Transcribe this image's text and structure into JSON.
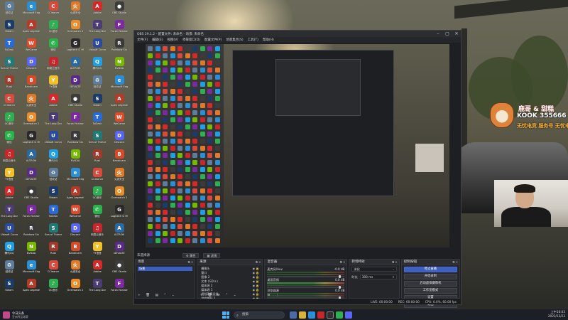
{
  "desktop": {
    "icons": [
      {
        "label": "回收站",
        "color": "#5f7d9a",
        "glyph": "♻"
      },
      {
        "label": "Microsoft Edge",
        "color": "#2a8fd6",
        "glyph": "e"
      },
      {
        "label": "CCleaner",
        "color": "#d94a3c",
        "glyph": "C"
      },
      {
        "label": "火绒安全",
        "color": "#e07a2a",
        "glyph": "火"
      },
      {
        "label": "Adobe",
        "color": "#d62a2a",
        "glyph": "A"
      },
      {
        "label": "OBS Studio",
        "color": "#3c3c3c",
        "glyph": "●"
      },
      {
        "label": "Steam",
        "color": "#1b3b6a",
        "glyph": "S"
      },
      {
        "label": "Apex Legends",
        "color": "#b43b2a",
        "glyph": "A"
      },
      {
        "label": "QQ音乐",
        "color": "#2fae52",
        "glyph": "♪"
      },
      {
        "label": "Overwatch 2",
        "color": "#e88d2a",
        "glyph": "O"
      },
      {
        "label": "The Long Dark",
        "color": "#4c3c76",
        "glyph": "T"
      },
      {
        "label": "Forza Horizon",
        "color": "#7b2aa0",
        "glyph": "F"
      },
      {
        "label": "ToDesk",
        "color": "#2a6ad6",
        "glyph": "T"
      },
      {
        "label": "WeGame",
        "color": "#e04a2a",
        "glyph": "W"
      },
      {
        "label": "微信",
        "color": "#29b34a",
        "glyph": "✆"
      },
      {
        "label": "Logitech G HUB",
        "color": "#2a2a2a",
        "glyph": "G"
      },
      {
        "label": "Ubisoft Connect",
        "color": "#2a4aa0",
        "glyph": "U"
      },
      {
        "label": "Rainbow Six",
        "color": "#3a3a3a",
        "glyph": "R"
      },
      {
        "label": "Sea of Thieves",
        "color": "#1f7a78",
        "glyph": "S"
      },
      {
        "label": "Discord",
        "color": "#5865f2",
        "glyph": "D"
      },
      {
        "label": "网易云音乐",
        "color": "#c8262a",
        "glyph": "♫"
      },
      {
        "label": "ALTRON",
        "color": "#2a6aa0",
        "glyph": "A"
      },
      {
        "label": "腾讯QQ",
        "color": "#1fa0e6",
        "glyph": "Q"
      },
      {
        "label": "NVIDIA",
        "color": "#76b900",
        "glyph": "N"
      },
      {
        "label": "Rust",
        "color": "#a03a2a",
        "glyph": "R"
      },
      {
        "label": "Bandicam",
        "color": "#d64a2a",
        "glyph": "B"
      },
      {
        "label": "YY语音",
        "color": "#f2c12a",
        "glyph": "Y"
      },
      {
        "label": "DEVIATE",
        "color": "#5a2a8a",
        "glyph": "D"
      }
    ]
  },
  "obs": {
    "title": "OBS 29.1.2 - 配置文件: 未命名 - 场景: 未命名",
    "menu": [
      "文件(F)",
      "编辑(E)",
      "视图(V)",
      "停靠窗口(D)",
      "配置文件(P)",
      "场景集合(S)",
      "工具(T)",
      "帮助(H)"
    ],
    "scene_label": "场景",
    "scene_current": "未选择源",
    "scene_tabs": [
      "⚙ 属性",
      "▦ 滤镜"
    ],
    "docks": {
      "scenes": {
        "title": "场景",
        "items": [
          "场景"
        ],
        "footer": "+ 🗑 ▤ ⌃ ⌄"
      },
      "sources": {
        "title": "来源",
        "items": [
          "摄像头",
          "窗口",
          "图像 2",
          "文本 (GDI+)",
          "媒体源 2",
          "媒体源 1",
          "视频采集设备",
          "游戏捕获 2"
        ],
        "footer": "+ 🗑 ⚙ ⌃ ⌄"
      },
      "mixer": {
        "title": "混音器",
        "tracks": [
          {
            "name": "麦克风/Aux",
            "db": "-0.0 dB"
          },
          {
            "name": "桌面音频",
            "db": "0.0 dB"
          },
          {
            "name": "浏览器源",
            "db": "0.0 dB"
          }
        ],
        "footer": "⚙ ⋮"
      },
      "transitions": {
        "title": "转场特效",
        "type": "淡化",
        "duration_label": "时长",
        "duration": "300 ms"
      },
      "controls": {
        "title": "控制按钮",
        "buttons": [
          "停止直播",
          "开始录制",
          "启动虚拟摄像机",
          "工作室模式",
          "设置",
          "退出"
        ]
      }
    },
    "status": {
      "live": "LIVE: 00:00:00",
      "rec": "REC: 00:00:00",
      "cpu": "CPU: 0.0%, 60.00 fps"
    }
  },
  "brand": {
    "top": "鹿哥 & 甜糕",
    "kook": "KOOK 355666",
    "sub": "无忧电竞 服务号 无忧电竞"
  },
  "taskbar": {
    "news_title": "今日头条",
    "news_sub": "亚洲杯足球赛",
    "search_placeholder": "搜索",
    "time": "上午10:03",
    "date": "2023/12/23"
  },
  "colors": {
    "obs_bg": "#1e1f22",
    "accent": "#3c5fc0",
    "meter_green": "#3e9a3c"
  }
}
